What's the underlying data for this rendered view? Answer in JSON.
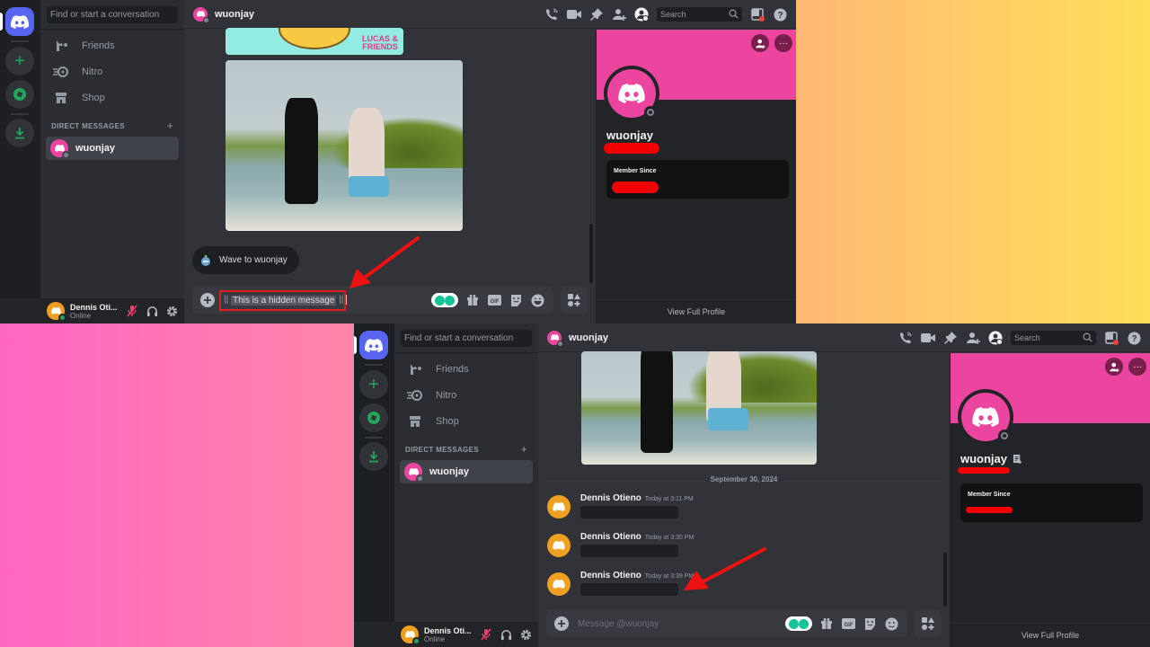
{
  "colors": {
    "brand": "#5865f2",
    "profile_banner": "#eb459f",
    "self_avatar": "#f0a020",
    "online": "#23a55a",
    "offline": "#80848e",
    "annotation_red": "#e31c1c"
  },
  "top": {
    "search_placeholder": "Find or start a conversation",
    "nav": [
      {
        "icon": "friends-icon",
        "label": "Friends"
      },
      {
        "icon": "nitro-icon",
        "label": "Nitro"
      },
      {
        "icon": "shop-icon",
        "label": "Shop"
      }
    ],
    "dm_header": "DIRECT MESSAGES",
    "dm_add": "+",
    "dm_user": "wuonjay",
    "user": {
      "name": "Dennis Oti...",
      "status": "Online"
    },
    "chat_title": "wuonjay",
    "header_search": "Search",
    "cartoon_logo": "LUCAS & FRIENDS",
    "wave_label": "Wave to wuonjay",
    "composer": {
      "prefix": "||",
      "value": "This is a hidden message",
      "suffix": "||"
    },
    "profile": {
      "name": "wuonjay",
      "member_since_label": "Member Since",
      "view_full": "View Full Profile"
    }
  },
  "bottom": {
    "search_placeholder": "Find or start a conversation",
    "nav": [
      {
        "icon": "friends-icon",
        "label": "Friends"
      },
      {
        "icon": "nitro-icon",
        "label": "Nitro"
      },
      {
        "icon": "shop-icon",
        "label": "Shop"
      }
    ],
    "dm_header": "DIRECT MESSAGES",
    "dm_add": "+",
    "dm_user": "wuonjay",
    "user": {
      "name": "Dennis Oti...",
      "status": "Online"
    },
    "chat_title": "wuonjay",
    "header_search": "Search",
    "date_divider": "September 30, 2024",
    "messages": [
      {
        "author": "Dennis Otieno",
        "time": "Today at 3:11 PM",
        "content": "spoiler"
      },
      {
        "author": "Dennis Otieno",
        "time": "Today at 3:30 PM",
        "content": "spoiler"
      },
      {
        "author": "Dennis Otieno",
        "time": "Today at 3:39 PM",
        "content": "spoiler"
      }
    ],
    "composer_placeholder": "Message @wuonjay",
    "profile": {
      "name": "wuonjay",
      "member_since_label": "Member Since",
      "view_full": "View Full Profile"
    }
  }
}
